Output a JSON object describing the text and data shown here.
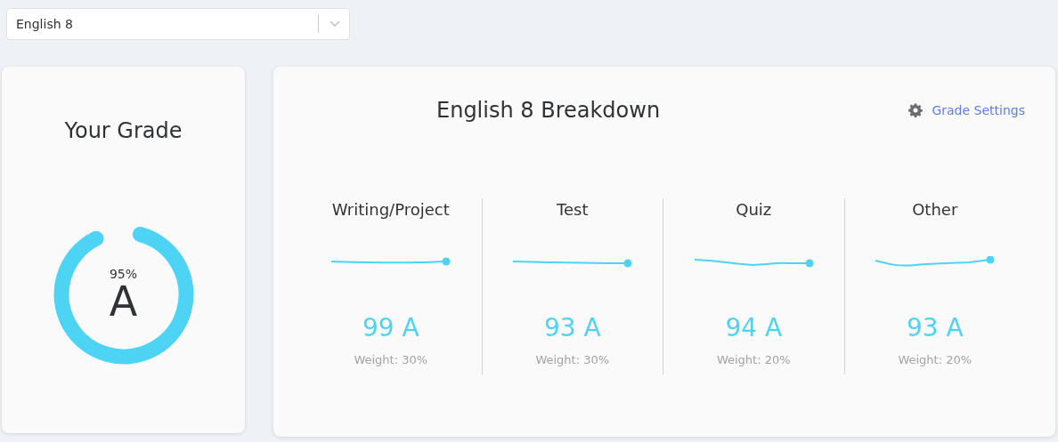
{
  "course_select": {
    "value": "English 8"
  },
  "grade_card": {
    "title": "Your Grade",
    "percent": "95%",
    "letter": "A",
    "level": 0.95
  },
  "breakdown": {
    "title": "English 8 Breakdown",
    "settings_link": "Grade Settings",
    "categories": [
      {
        "name": "Writing/Project",
        "score": "99 A",
        "weight": "Weight: 30%"
      },
      {
        "name": "Test",
        "score": "93 A",
        "weight": "Weight: 30%"
      },
      {
        "name": "Quiz",
        "score": "94 A",
        "weight": "Weight: 20%"
      },
      {
        "name": "Other",
        "score": "93 A",
        "weight": "Weight: 20%"
      }
    ]
  }
}
